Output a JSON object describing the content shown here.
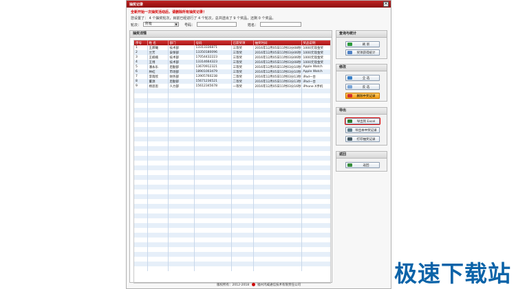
{
  "window": {
    "title": "抽奖记录",
    "close_label": "×"
  },
  "notice": "全新开始一次抽奖活动后，请删除所有抽奖记录！",
  "status": "您设置了： 4 个抽奖轮次，目前已经进行了 4 个轮次，总共送出了 9 个奖品，还剩 0 个奖品。",
  "filters": {
    "round_label": "轮次：",
    "round_value": "所有",
    "phone_label": "号码：",
    "name_label": "姓名："
  },
  "details": {
    "title": "抽奖详情",
    "columns": [
      "序号",
      "姓 名",
      "部门",
      "号码",
      "已获奖项",
      "抽奖时间",
      "奖品说明"
    ],
    "rows": [
      [
        "1",
        "王郝曦",
        "技术部",
        "13313336871",
        "三等奖",
        "2016年12月05日11时03分08秒",
        "1000元现金奖"
      ],
      [
        "2",
        "兰芳",
        "安保部",
        "13350180096",
        "三等奖",
        "2016年12月05日11时03分06秒",
        "1000元现金奖"
      ],
      [
        "3",
        "王楠楠",
        "技术部",
        "17054432223",
        "三等奖",
        "2016年12月05日11时03分06秒",
        "1000元现金奖"
      ],
      [
        "4",
        "王博",
        "技术部",
        "13314664323",
        "三等奖",
        "2016年12月05日11时03分08秒",
        "1000元现金奖"
      ],
      [
        "5",
        "潘永乐",
        "后勤部",
        "13670912321",
        "三等奖",
        "2016年12月05日11时03分10秒",
        "Apple Watch"
      ],
      [
        "6",
        "林虹",
        "市场部",
        "18901003479",
        "三等奖",
        "2016年12月05日11时03分10秒",
        "Apple Watch"
      ],
      [
        "7",
        "李雨欣",
        "财务部",
        "13905760238",
        "二等奖",
        "2016年12月05日11时03分13秒",
        "iPad一台"
      ],
      [
        "8",
        "董源",
        "后勤部",
        "15671236521",
        "二等奖",
        "2016年12月05日11时03分13秒",
        "iPad一台"
      ],
      [
        "9",
        "杨思思",
        "人力部",
        "15612345678",
        "一等奖",
        "2016年12月05日11时03分16秒",
        "iPhone X手机"
      ]
    ],
    "empty_rows": 38
  },
  "query_panel": {
    "title": "查询与统计",
    "refresh": "刷 新",
    "stats": "奖项获得统计"
  },
  "modify_panel": {
    "title": "修改",
    "select_all": "全 选",
    "deselect": "反 选",
    "delete": "删除中奖记录"
  },
  "export_panel": {
    "title": "导出",
    "excel": "导出到 Excel",
    "text": "导出本中奖记录",
    "print": "打印抽奖记录"
  },
  "return_panel": {
    "title": "返回",
    "back": "返回"
  },
  "footer": {
    "copyright": "版权所有：2012-2018",
    "company": "福州鸿威通信技术有限责任公司"
  },
  "watermark": "极速下载站"
}
